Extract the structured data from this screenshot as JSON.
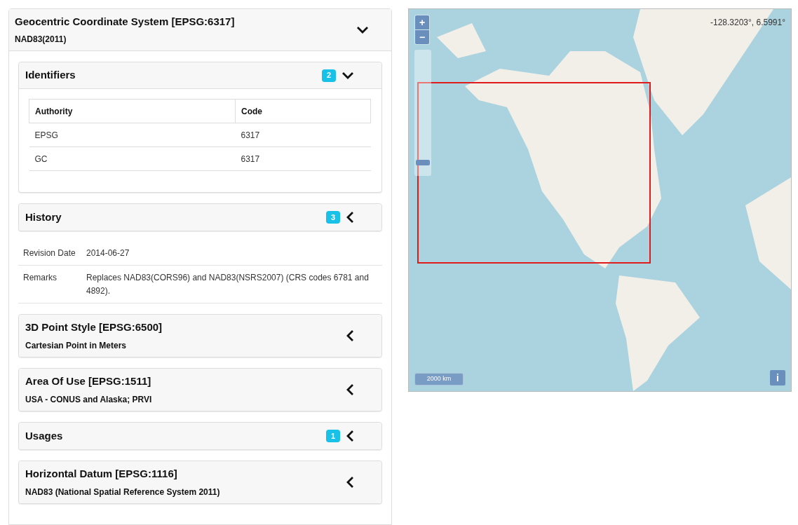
{
  "panel": {
    "title": "Geocentric Coordinate System [EPSG:6317]",
    "subtitle": "NAD83(2011)",
    "expanded": true
  },
  "sections": [
    {
      "kind": "table",
      "title": "Identifiers",
      "count": "2",
      "expanded": true,
      "columns": [
        "Authority",
        "Code"
      ],
      "rows": [
        [
          "EPSG",
          "6317"
        ],
        [
          "GC",
          "6317"
        ]
      ]
    },
    {
      "kind": "details",
      "title": "History",
      "count": "3",
      "expanded": false,
      "details": [
        {
          "label": "Revision Date",
          "value": "2014-06-27"
        },
        {
          "label": "Remarks",
          "value": "Replaces NAD83(CORS96) and NAD83(NSRS2007) (CRS codes 6781 and 4892)."
        }
      ]
    },
    {
      "kind": "header",
      "title": "3D Point Style [EPSG:6500]",
      "subtitle": "Cartesian Point in Meters",
      "expanded": false
    },
    {
      "kind": "header",
      "title": "Area Of Use [EPSG:1511]",
      "subtitle": "USA - CONUS and Alaska; PRVI",
      "expanded": false
    },
    {
      "kind": "header",
      "title": "Usages",
      "count": "1",
      "expanded": false
    },
    {
      "kind": "header",
      "title": "Horizontal Datum [EPSG:1116]",
      "subtitle": "NAD83 (National Spatial Reference System 2011)",
      "expanded": false
    }
  ],
  "map": {
    "zoom_in": "+",
    "zoom_out": "−",
    "zoom_slider": {
      "level": 0.09
    },
    "coordinates": "-128.3203°, 6.5991°",
    "scale": "2000 km",
    "info": "i"
  }
}
